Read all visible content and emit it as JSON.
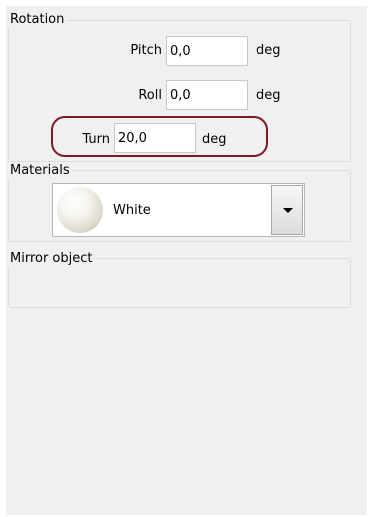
{
  "rotation": {
    "title": "Rotation",
    "pitch": {
      "label": "Pitch",
      "value": "0,0",
      "unit": "deg"
    },
    "roll": {
      "label": "Roll",
      "value": "0,0",
      "unit": "deg"
    },
    "turn": {
      "label": "Turn",
      "value": "20,0",
      "unit": "deg"
    }
  },
  "materials": {
    "title": "Materials",
    "selected": "White",
    "preview_icon": "material-sphere-icon",
    "dropdown_icon": "chevron-down-icon"
  },
  "mirror": {
    "title": "Mirror object"
  },
  "colors": {
    "highlight": "#7a1c20",
    "panel_background": "#f0f0f0"
  }
}
